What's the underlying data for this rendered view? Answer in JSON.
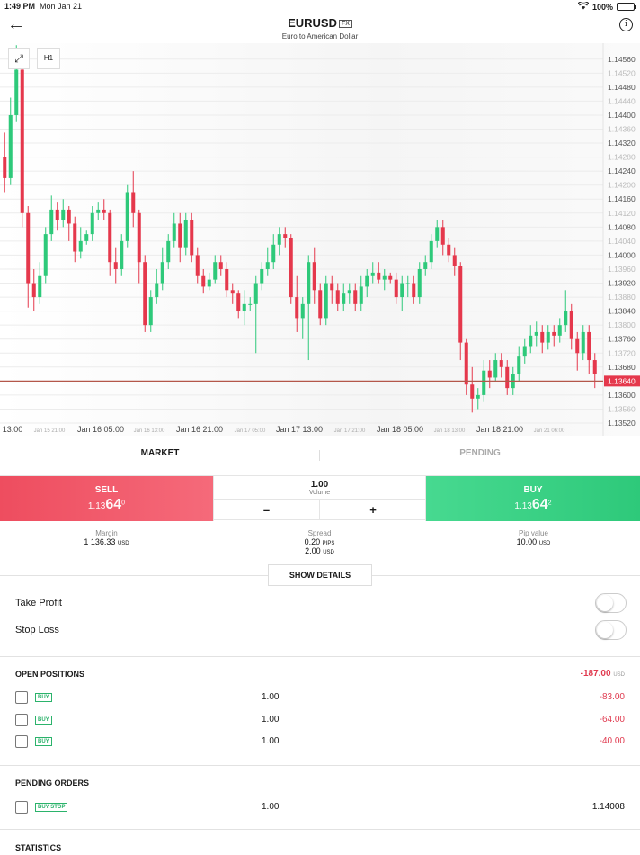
{
  "status_bar": {
    "time": "1:49 PM",
    "date": "Mon Jan 21",
    "battery": "100%"
  },
  "header": {
    "title": "EURUSD",
    "badge": "FX",
    "subtitle": "Euro to American Dollar"
  },
  "chart_toolbar": {
    "timeframe": "H1"
  },
  "chart_data": {
    "type": "candlestick",
    "current_price": "1.13640",
    "ylim": [
      1.1352,
      1.1458
    ],
    "y_ticks": [
      "1.14560",
      "1.14520",
      "1.14480",
      "1.14440",
      "1.14400",
      "1.14360",
      "1.14320",
      "1.14280",
      "1.14240",
      "1.14200",
      "1.14160",
      "1.14120",
      "1.14080",
      "1.14040",
      "1.14000",
      "1.13960",
      "1.13920",
      "1.13880",
      "1.13840",
      "1.13800",
      "1.13760",
      "1.13720",
      "1.13680",
      "1.13640",
      "1.13600",
      "1.13560",
      "1.13520"
    ],
    "x_ticks": [
      {
        "label": "13:00",
        "major": true
      },
      {
        "label": "Jan 15 21:00",
        "major": false
      },
      {
        "label": "Jan 16 05:00",
        "major": true
      },
      {
        "label": "Jan 16 13:00",
        "major": false
      },
      {
        "label": "Jan 16 21:00",
        "major": true
      },
      {
        "label": "Jan 17 05:00",
        "major": false
      },
      {
        "label": "Jan 17 13:00",
        "major": true
      },
      {
        "label": "Jan 17 21:00",
        "major": false
      },
      {
        "label": "Jan 18 05:00",
        "major": true
      },
      {
        "label": "Jan 18 13:00",
        "major": false
      },
      {
        "label": "Jan 18 21:00",
        "major": true
      },
      {
        "label": "Jan 21 06:00",
        "major": false
      }
    ],
    "candles": [
      [
        1.1428,
        1.1422,
        1.1435,
        1.1418
      ],
      [
        1.1422,
        1.144,
        1.1445,
        1.142
      ],
      [
        1.144,
        1.1453,
        1.146,
        1.1438
      ],
      [
        1.1453,
        1.1412,
        1.1458,
        1.1408
      ],
      [
        1.1412,
        1.1392,
        1.1414,
        1.1385
      ],
      [
        1.1392,
        1.1388,
        1.1396,
        1.1384
      ],
      [
        1.1388,
        1.1394,
        1.1398,
        1.1386
      ],
      [
        1.1394,
        1.1406,
        1.1408,
        1.1392
      ],
      [
        1.1406,
        1.1413,
        1.1417,
        1.1404
      ],
      [
        1.1413,
        1.141,
        1.1415,
        1.1407
      ],
      [
        1.141,
        1.1413,
        1.1416,
        1.1408
      ],
      [
        1.1413,
        1.1409,
        1.1414,
        1.1404
      ],
      [
        1.1409,
        1.1401,
        1.1411,
        1.1398
      ],
      [
        1.1401,
        1.1404,
        1.1408,
        1.1399
      ],
      [
        1.1404,
        1.1406,
        1.1407,
        1.1403
      ],
      [
        1.1406,
        1.1412,
        1.1414,
        1.1404
      ],
      [
        1.1412,
        1.1413,
        1.1415,
        1.141
      ],
      [
        1.1413,
        1.1412,
        1.1416,
        1.141
      ],
      [
        1.1412,
        1.1398,
        1.1413,
        1.1394
      ],
      [
        1.1398,
        1.1396,
        1.1402,
        1.1392
      ],
      [
        1.1396,
        1.1404,
        1.1406,
        1.1394
      ],
      [
        1.1404,
        1.1418,
        1.142,
        1.1402
      ],
      [
        1.1418,
        1.1412,
        1.1424,
        1.1408
      ],
      [
        1.1412,
        1.1398,
        1.1413,
        1.1392
      ],
      [
        1.1398,
        1.138,
        1.14,
        1.1378
      ],
      [
        1.138,
        1.1388,
        1.139,
        1.1378
      ],
      [
        1.1388,
        1.1392,
        1.1396,
        1.1386
      ],
      [
        1.1392,
        1.1398,
        1.1402,
        1.139
      ],
      [
        1.1398,
        1.1404,
        1.1406,
        1.1396
      ],
      [
        1.1404,
        1.1409,
        1.1412,
        1.1402
      ],
      [
        1.1409,
        1.1402,
        1.1412,
        1.1398
      ],
      [
        1.1402,
        1.141,
        1.1412,
        1.14
      ],
      [
        1.141,
        1.14,
        1.1412,
        1.1398
      ],
      [
        1.14,
        1.1394,
        1.1402,
        1.1392
      ],
      [
        1.1394,
        1.1391,
        1.1396,
        1.1389
      ],
      [
        1.1391,
        1.1393,
        1.1395,
        1.139
      ],
      [
        1.1393,
        1.1398,
        1.14,
        1.1392
      ],
      [
        1.1398,
        1.1396,
        1.14,
        1.1394
      ],
      [
        1.1396,
        1.139,
        1.1398,
        1.1388
      ],
      [
        1.139,
        1.1389,
        1.1392,
        1.1386
      ],
      [
        1.1389,
        1.1384,
        1.139,
        1.1382
      ],
      [
        1.1384,
        1.1386,
        1.139,
        1.138
      ],
      [
        1.1386,
        1.1386,
        1.1388,
        1.1384
      ],
      [
        1.1386,
        1.1392,
        1.1394,
        1.1372
      ],
      [
        1.1392,
        1.1396,
        1.1398,
        1.139
      ],
      [
        1.1396,
        1.1398,
        1.1402,
        1.1394
      ],
      [
        1.1398,
        1.1403,
        1.1406,
        1.1396
      ],
      [
        1.1403,
        1.1406,
        1.1408,
        1.14
      ],
      [
        1.1406,
        1.1405,
        1.1408,
        1.1402
      ],
      [
        1.1405,
        1.1388,
        1.1406,
        1.1386
      ],
      [
        1.1388,
        1.1382,
        1.1394,
        1.1378
      ],
      [
        1.1382,
        1.1386,
        1.1388,
        1.1376
      ],
      [
        1.1386,
        1.1398,
        1.14,
        1.137
      ],
      [
        1.1398,
        1.139,
        1.1402,
        1.1386
      ],
      [
        1.139,
        1.1382,
        1.1392,
        1.138
      ],
      [
        1.1382,
        1.1392,
        1.1394,
        1.138
      ],
      [
        1.1392,
        1.139,
        1.1394,
        1.1386
      ],
      [
        1.139,
        1.1386,
        1.1392,
        1.1384
      ],
      [
        1.1386,
        1.1389,
        1.1392,
        1.1384
      ],
      [
        1.1389,
        1.139,
        1.1392,
        1.1386
      ],
      [
        1.139,
        1.1386,
        1.1392,
        1.1384
      ],
      [
        1.1386,
        1.1391,
        1.1394,
        1.1384
      ],
      [
        1.1391,
        1.1394,
        1.1396,
        1.1388
      ],
      [
        1.1394,
        1.1395,
        1.1398,
        1.1392
      ],
      [
        1.1395,
        1.1393,
        1.1398,
        1.1392
      ],
      [
        1.1393,
        1.1394,
        1.1396,
        1.139
      ],
      [
        1.1394,
        1.1393,
        1.1395,
        1.1392
      ],
      [
        1.1393,
        1.1388,
        1.1395,
        1.1386
      ],
      [
        1.1388,
        1.1392,
        1.1394,
        1.1384
      ],
      [
        1.1392,
        1.1392,
        1.1394,
        1.1388
      ],
      [
        1.1392,
        1.1388,
        1.1394,
        1.1386
      ],
      [
        1.1388,
        1.1396,
        1.1398,
        1.1386
      ],
      [
        1.1396,
        1.1398,
        1.14,
        1.1394
      ],
      [
        1.1398,
        1.1404,
        1.1406,
        1.1396
      ],
      [
        1.1404,
        1.1408,
        1.141,
        1.1402
      ],
      [
        1.1408,
        1.1403,
        1.141,
        1.14
      ],
      [
        1.1403,
        1.14,
        1.1405,
        1.1398
      ],
      [
        1.14,
        1.1397,
        1.1402,
        1.1394
      ],
      [
        1.1397,
        1.1375,
        1.1398,
        1.137
      ],
      [
        1.1375,
        1.1363,
        1.1376,
        1.136
      ],
      [
        1.1363,
        1.1359,
        1.1368,
        1.1355
      ],
      [
        1.1359,
        1.136,
        1.1362,
        1.1356
      ],
      [
        1.136,
        1.1367,
        1.137,
        1.1358
      ],
      [
        1.1367,
        1.1365,
        1.137,
        1.1362
      ],
      [
        1.1365,
        1.137,
        1.1372,
        1.1364
      ],
      [
        1.137,
        1.1368,
        1.1372,
        1.1365
      ],
      [
        1.1368,
        1.1362,
        1.137,
        1.136
      ],
      [
        1.1362,
        1.1366,
        1.1368,
        1.136
      ],
      [
        1.1366,
        1.1371,
        1.1374,
        1.1364
      ],
      [
        1.1371,
        1.1374,
        1.1376,
        1.1369
      ],
      [
        1.1374,
        1.1377,
        1.138,
        1.1372
      ],
      [
        1.1377,
        1.1378,
        1.1381,
        1.1374
      ],
      [
        1.1378,
        1.1375,
        1.138,
        1.1372
      ],
      [
        1.1375,
        1.1378,
        1.138,
        1.1373
      ],
      [
        1.1378,
        1.1377,
        1.138,
        1.1374
      ],
      [
        1.1377,
        1.138,
        1.1382,
        1.1375
      ],
      [
        1.138,
        1.1384,
        1.139,
        1.1378
      ],
      [
        1.1384,
        1.1376,
        1.1386,
        1.1373
      ],
      [
        1.1376,
        1.1372,
        1.1378,
        1.1367
      ],
      [
        1.1372,
        1.1378,
        1.138,
        1.137
      ],
      [
        1.1378,
        1.137,
        1.138,
        1.1366
      ],
      [
        1.137,
        1.1366,
        1.1372,
        1.1362
      ]
    ]
  },
  "tabs": {
    "market": "MARKET",
    "pending": "PENDING"
  },
  "trade": {
    "sell": {
      "label": "SELL",
      "price_prefix": "1.13",
      "price_big": "64",
      "price_sup": "0"
    },
    "buy": {
      "label": "BUY",
      "price_prefix": "1.13",
      "price_big": "64",
      "price_sup": "2"
    },
    "volume": {
      "value": "1.00",
      "label": "Volume",
      "minus": "–",
      "plus": "+"
    }
  },
  "stats": {
    "margin": {
      "label": "Margin",
      "value": "1 136.33",
      "unit": "USD"
    },
    "spread": {
      "label": "Spread",
      "pips": "0.20",
      "pips_unit": "PIPS",
      "usd": "2.00",
      "usd_unit": "USD"
    },
    "pip_value": {
      "label": "Pip value",
      "value": "10.00",
      "unit": "USD"
    }
  },
  "show_details": "SHOW DETAILS",
  "take_profit": "Take Profit",
  "stop_loss": "Stop Loss",
  "open_positions": {
    "title": "OPEN POSITIONS",
    "total": "-187.00",
    "total_unit": "USD",
    "rows": [
      {
        "type": "BUY",
        "volume": "1.00",
        "pl": "-83.00"
      },
      {
        "type": "BUY",
        "volume": "1.00",
        "pl": "-64.00"
      },
      {
        "type": "BUY",
        "volume": "1.00",
        "pl": "-40.00"
      }
    ]
  },
  "pending_orders": {
    "title": "PENDING ORDERS",
    "rows": [
      {
        "type": "BUY STOP",
        "volume": "1.00",
        "price": "1.14008"
      }
    ]
  },
  "statistics": {
    "title": "STATISTICS"
  },
  "colors": {
    "bull": "#2ec97a",
    "bear": "#e5384c",
    "price_line": "#b4574a"
  }
}
